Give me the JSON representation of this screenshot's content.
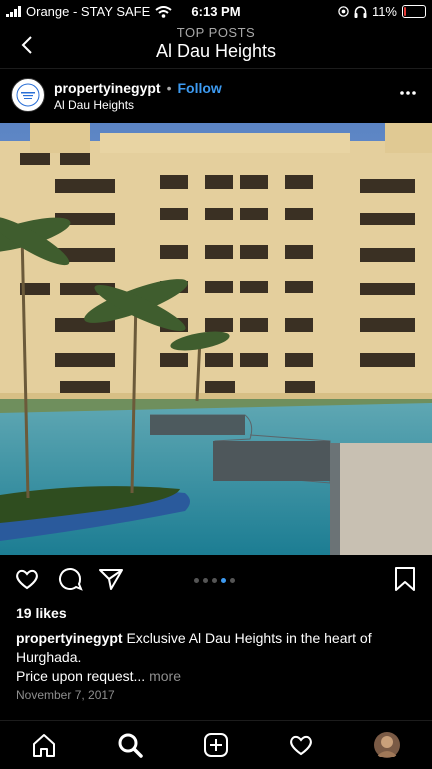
{
  "status_bar": {
    "carrier": "Orange - STAY SAFE",
    "time": "6:13 PM",
    "battery_percent": "11%",
    "battery_level": 0.11,
    "battery_color": "#e53935"
  },
  "header": {
    "subtitle": "TOP POSTS",
    "title": "Al Dau Heights"
  },
  "post": {
    "username": "propertyinegypt",
    "separator": "•",
    "follow_label": "Follow",
    "location": "Al Dau Heights",
    "carousel": {
      "count": 5,
      "active_index": 3
    },
    "likes": "19 likes",
    "caption_line1": "Exclusive Al Dau Heights in the heart of Hurghada.",
    "caption_line2": "Price upon request...",
    "more_label": "more",
    "date": "November 7, 2017"
  },
  "icons": {
    "status": [
      "signal-icon",
      "wifi-icon",
      "location-icon",
      "headphones-icon",
      "battery-icon"
    ],
    "header": [
      "back-icon"
    ],
    "post_actions": [
      "heart-icon",
      "comment-icon",
      "share-icon",
      "bookmark-icon",
      "more-icon"
    ],
    "tabs": [
      "home-icon",
      "search-icon",
      "add-post-icon",
      "activity-icon",
      "profile-avatar"
    ]
  },
  "colors": {
    "background": "#000000",
    "link_blue": "#3d9af0",
    "secondary_text": "#8e8e8e"
  }
}
